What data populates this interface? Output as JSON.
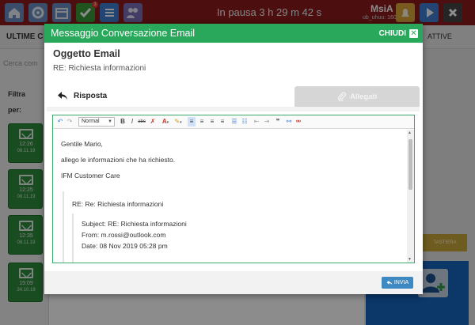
{
  "app": {
    "timer": "In pausa  3 h 29 m 42 s",
    "user": {
      "name": "MsiA",
      "id": "ub_uhuu: 1607"
    },
    "badge_count": "3",
    "tabs": {
      "left": "ULTIME C",
      "right": "ATTIVE"
    },
    "search_placeholder": "Cerca com",
    "filter_label": "Filtra",
    "filter_by": "per:",
    "conversations": [
      {
        "time": "12:26",
        "date": "08.11.19"
      },
      {
        "time": "12:25",
        "date": "08.11.19"
      },
      {
        "time": "12:35",
        "date": "08.11.19"
      },
      {
        "time": "15:09",
        "date": "24.10.19"
      }
    ],
    "keyboard_button": "TASTIERA"
  },
  "modal": {
    "title": "Messaggio Conversazione Email",
    "close_label": "CHIUDI",
    "subject_heading": "Oggetto Email",
    "subject_value": "RE:  Richiesta informazioni",
    "tabs": {
      "reply": "Risposta",
      "attachments": "Allegati"
    },
    "toolbar": {
      "format": "Normal"
    },
    "body": {
      "greeting": "Gentile Mario,",
      "line1": "allego le informazioni che ha richiesto.",
      "signature": "IFM Customer Care",
      "quote_header": "RE: Re: Richiesta informazioni",
      "quoted_subject": "Subject: RE: Richiesta informazioni",
      "quoted_from": "From: m.rossi@outlook.com",
      "quoted_date": "Date: 08 Nov 2019 05:28 pm"
    },
    "send_label": "INVIA"
  },
  "colors": {
    "topbar": "#8b1a1a",
    "modal_header": "#29a85b",
    "send_button": "#3f89c2",
    "conversation_tile": "#2e8b3c"
  }
}
